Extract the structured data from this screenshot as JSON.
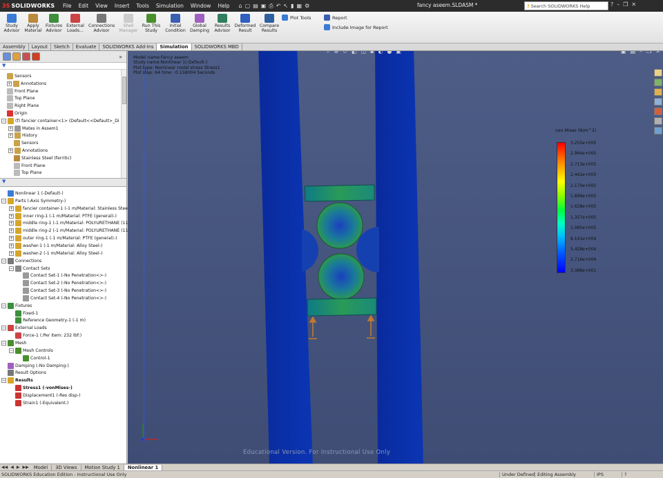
{
  "app": {
    "logo_ds": "3S",
    "logo_text": "SOLIDWORKS",
    "document_title": "fancy aseem.SLDASM *",
    "help_search_placeholder": "Search SOLIDWORKS Help"
  },
  "menu": [
    "File",
    "Edit",
    "View",
    "Insert",
    "Tools",
    "Simulation",
    "Window",
    "Help"
  ],
  "ribbon": {
    "buttons": [
      {
        "label": "Study Advisor",
        "color": "#3a7bd5"
      },
      {
        "label": "Apply Material",
        "color": "#b98a3c"
      },
      {
        "label": "Fixtures Advisor",
        "color": "#3d8f3d"
      },
      {
        "label": "External Loads...",
        "color": "#c44"
      },
      {
        "label": "Connections Advisor",
        "color": "#777"
      },
      {
        "label": "Shell Manager",
        "color": "#bbb"
      },
      {
        "label": "Run This Study",
        "color": "#4a8f2c"
      },
      {
        "label": "Initial Condition",
        "color": "#3a5fb0"
      },
      {
        "label": "Global Damping",
        "color": "#a060c0"
      },
      {
        "label": "Results Advisor",
        "color": "#2f7f5f"
      },
      {
        "label": "Deformed Result",
        "color": "#2f5fbf"
      },
      {
        "label": "Compare Results",
        "color": "#2f5f9f"
      }
    ],
    "plot_tools": "Plot Tools",
    "report": "Report",
    "include_image": "Include Image for Report"
  },
  "command_tabs": [
    "Assembly",
    "Layout",
    "Sketch",
    "Evaluate",
    "SOLIDWORKS Add-Ins",
    "Simulation",
    "SOLIDWORKS MBD"
  ],
  "active_command_tab": "Simulation",
  "feature_tree": [
    {
      "label": "Sensors",
      "icon": "sensors-icon",
      "color": "#c9a24a"
    },
    {
      "label": "Annotations",
      "icon": "annotations-icon",
      "color": "#c9a24a",
      "expand": "+"
    },
    {
      "label": "Front Plane",
      "icon": "plane-icon",
      "color": "#bbb"
    },
    {
      "label": "Top Plane",
      "icon": "plane-icon",
      "color": "#bbb"
    },
    {
      "label": "Right Plane",
      "icon": "plane-icon",
      "color": "#bbb"
    },
    {
      "label": "Origin",
      "icon": "origin-icon",
      "color": "#d33"
    },
    {
      "label": "(f) fancier container<1> (Default<<Default>_Di",
      "icon": "part-icon",
      "color": "#d6a52a",
      "expand": "−"
    },
    {
      "label": "Mates in Assem1",
      "icon": "mates-icon",
      "color": "#999",
      "expand": "+"
    },
    {
      "label": "History",
      "icon": "history-icon",
      "color": "#c9a24a",
      "expand": "+"
    },
    {
      "label": "Sensors",
      "icon": "sensors-icon",
      "color": "#c9a24a"
    },
    {
      "label": "Annotations",
      "icon": "annotations-icon",
      "color": "#c9a24a",
      "expand": "+"
    },
    {
      "label": "Stainless Steel (ferritic)",
      "icon": "material-icon",
      "color": "#b98a3c"
    },
    {
      "label": "Front Plane",
      "icon": "plane-icon",
      "color": "#bbb"
    },
    {
      "label": "Top Plane",
      "icon": "plane-icon",
      "color": "#bbb"
    }
  ],
  "study_tree": [
    {
      "label": "Nonlinear 1 (-Default-)",
      "icon": "study-icon",
      "color": "#3a7bd5",
      "level": 0
    },
    {
      "label": "Parts (-Axis Symmetry-)",
      "icon": "parts-icon",
      "color": "#d6a52a",
      "level": 0,
      "expand": "−"
    },
    {
      "label": "fancier container-1 (-1 m/Material: Stainless Stee",
      "icon": "part-icon",
      "color": "#d6a52a",
      "level": 1,
      "expand": "+"
    },
    {
      "label": "inner ring-1 (-1 m/Material: PTFE (general)-)",
      "icon": "part-icon",
      "color": "#d6a52a",
      "level": 1,
      "expand": "+"
    },
    {
      "label": "middle ring-1 (-1 m/Material: POLYURETHANE (11",
      "icon": "part-icon",
      "color": "#d6a52a",
      "level": 1,
      "expand": "+"
    },
    {
      "label": "middle ring-2 (-1 m/Material: POLYURETHANE (11",
      "icon": "part-icon",
      "color": "#d6a52a",
      "level": 1,
      "expand": "+"
    },
    {
      "label": "outer ring-1 (-1 m/Material: PTFE (general)-)",
      "icon": "part-icon",
      "color": "#d6a52a",
      "level": 1,
      "expand": "+"
    },
    {
      "label": "washer-1 (-1 m/Material: Alloy Steel-)",
      "icon": "part-icon",
      "color": "#d6a52a",
      "level": 1,
      "expand": "+"
    },
    {
      "label": "washer-2 (-1 m/Material: Alloy Steel-)",
      "icon": "part-icon",
      "color": "#d6a52a",
      "level": 1,
      "expand": "+"
    },
    {
      "label": "Connections",
      "icon": "connections-icon",
      "color": "#777",
      "level": 0,
      "expand": "−"
    },
    {
      "label": "Contact Sets",
      "icon": "contact-sets-icon",
      "color": "#888",
      "level": 1,
      "expand": "−"
    },
    {
      "label": "Contact Set-1 (-No Penetration<>-)",
      "icon": "contact-set-icon",
      "color": "#999",
      "level": 2
    },
    {
      "label": "Contact Set-2 (-No Penetration<>-)",
      "icon": "contact-set-icon",
      "color": "#999",
      "level": 2
    },
    {
      "label": "Contact Set-3 (-No Penetration<>-)",
      "icon": "contact-set-icon",
      "color": "#999",
      "level": 2
    },
    {
      "label": "Contact Set-4 (-No Penetration<>-)",
      "icon": "contact-set-icon",
      "color": "#999",
      "level": 2
    },
    {
      "label": "Fixtures",
      "icon": "fixtures-icon",
      "color": "#3d8f3d",
      "level": 0,
      "expand": "−"
    },
    {
      "label": "Fixed-1",
      "icon": "fixed-icon",
      "color": "#3d8f3d",
      "level": 1
    },
    {
      "label": "Reference Geometry-1 (-1 m)",
      "icon": "reference-geometry-icon",
      "color": "#3d8f3d",
      "level": 1
    },
    {
      "label": "External Loads",
      "icon": "external-loads-icon",
      "color": "#c44",
      "level": 0,
      "expand": "−"
    },
    {
      "label": "Force-1 (:Per item: 232 lbf:)",
      "icon": "force-icon",
      "color": "#c44",
      "level": 1
    },
    {
      "label": "Mesh",
      "icon": "mesh-icon",
      "color": "#4a8f2c",
      "level": 0,
      "expand": "−"
    },
    {
      "label": "Mesh Controls",
      "icon": "mesh-controls-icon",
      "color": "#4a8f2c",
      "level": 1,
      "expand": "−"
    },
    {
      "label": "Control-1",
      "icon": "control-icon",
      "color": "#4a8f2c",
      "level": 2
    },
    {
      "label": "Damping (-No Damping-)",
      "icon": "damping-icon",
      "color": "#a060c0",
      "level": 0
    },
    {
      "label": "Result Options",
      "icon": "result-options-icon",
      "color": "#777",
      "level": 0
    },
    {
      "label": "Results",
      "icon": "results-icon",
      "color": "#d6a52a",
      "level": 0,
      "expand": "−",
      "bold": true
    },
    {
      "label": "Stress1 (-vonMises-)",
      "icon": "stress-plot-icon",
      "color": "#c33",
      "level": 1,
      "bold": true
    },
    {
      "label": "Displacement1 (-Res disp-)",
      "icon": "displacement-plot-icon",
      "color": "#c33",
      "level": 1
    },
    {
      "label": "Strain1 (-Equivalent-)",
      "icon": "strain-plot-icon",
      "color": "#c33",
      "level": 1
    }
  ],
  "viewport": {
    "info_lines": [
      "Model name:fancy aseem",
      "Study name:Nonlinear 1(-Default-)",
      "Plot type: Nonlinear nodal stress Stress1",
      "Plot step: 64   time : 0.158004 Seconds"
    ],
    "watermark": "Educational Version. For Instructional Use Only",
    "legend": {
      "title": "von Mises (N/m^2)",
      "values": [
        "3.255e+005",
        "2.984e+005",
        "2.713e+005",
        "2.442e+005",
        "2.170e+005",
        "1.899e+005",
        "1.628e+005",
        "1.357e+005",
        "1.085e+005",
        "8.141e+004",
        "5.428e+004",
        "2.716e+004",
        "3.388e+001"
      ]
    }
  },
  "bottom_tabs": [
    "Model",
    "3D Views",
    "Motion Study 1",
    "Nonlinear 1"
  ],
  "active_bottom_tab": "Nonlinear 1",
  "status": {
    "edition": "SOLIDWORKS Education Edition - Instructional Use Only",
    "under_defined": "Under Defined",
    "editing": "Editing Assembly",
    "units": "IPS"
  }
}
